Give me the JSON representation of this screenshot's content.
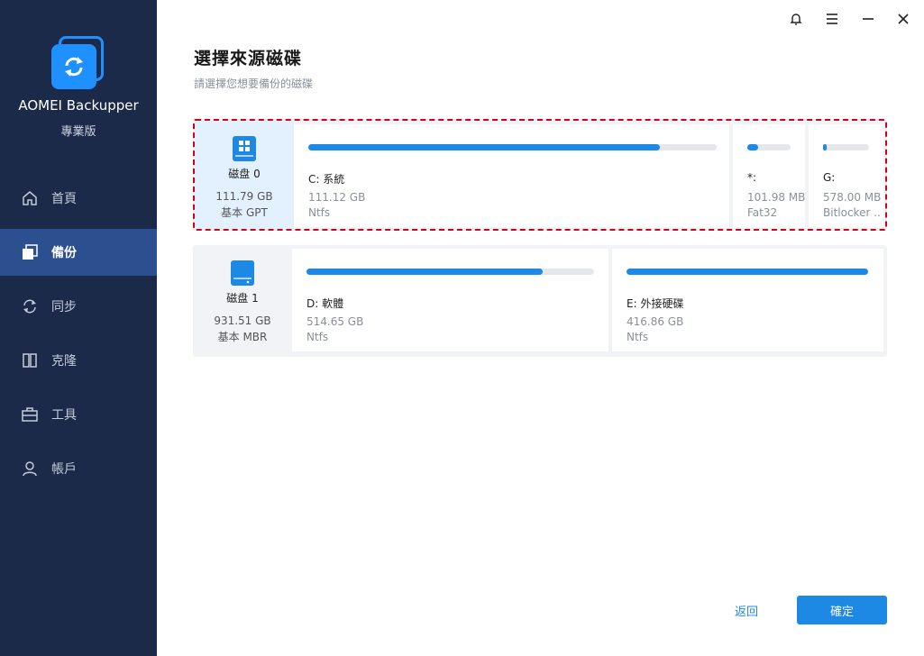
{
  "app": {
    "name": "AOMEI Backupper",
    "edition": "專業版"
  },
  "nav": [
    {
      "label": "首頁",
      "icon": "home-icon"
    },
    {
      "label": "備份",
      "icon": "backup-icon",
      "active": true
    },
    {
      "label": "同步",
      "icon": "sync-icon"
    },
    {
      "label": "克隆",
      "icon": "clone-icon"
    },
    {
      "label": "工具",
      "icon": "tools-icon"
    },
    {
      "label": "帳戶",
      "icon": "account-icon"
    }
  ],
  "header": {
    "title": "選擇來源磁碟",
    "subtitle": "請選擇您想要備份的磁碟"
  },
  "disks": [
    {
      "name": "磁盘 0",
      "size": "111.79 GB",
      "type": "基本 GPT",
      "selected": true,
      "partitions": [
        {
          "label": "C: 系統",
          "size": "111.12 GB",
          "fs": "Ntfs",
          "used_fraction": 0.86
        },
        {
          "label": "*:",
          "size": "101.98 MB",
          "fs": "Fat32",
          "used_fraction": 0.25
        },
        {
          "label": "G:",
          "size": "578.00 MB",
          "fs": "Bitlocker ...",
          "used_fraction": 0.08
        }
      ]
    },
    {
      "name": "磁盘 1",
      "size": "931.51 GB",
      "type": "基本 MBR",
      "selected": false,
      "partitions": [
        {
          "label": "D: 軟體",
          "size": "514.65 GB",
          "fs": "Ntfs",
          "used_fraction": 0.82
        },
        {
          "label": "E: 外接硬碟",
          "size": "416.86 GB",
          "fs": "Ntfs",
          "used_fraction": 1.0
        }
      ]
    }
  ],
  "footer": {
    "back_label": "返回",
    "ok_label": "確定"
  },
  "colors": {
    "sidebar": "#1b2a49",
    "active_nav": "#2b4f8f",
    "accent": "#1e88e5",
    "selected_border": "#d0021b"
  }
}
